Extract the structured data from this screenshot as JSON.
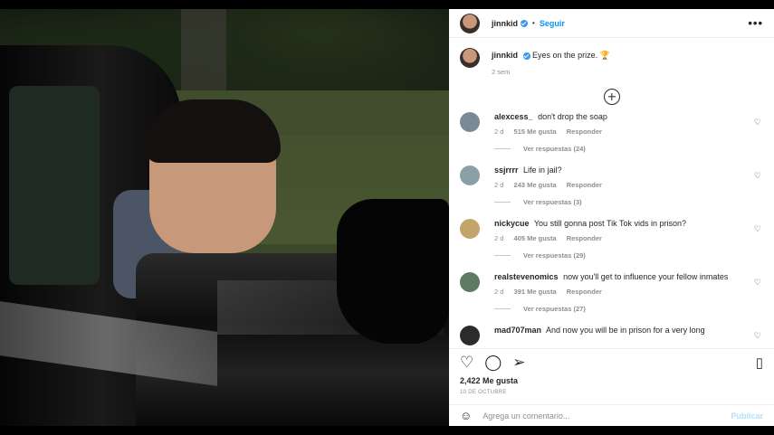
{
  "post": {
    "username": "jinnkid",
    "follow_label": "Seguir",
    "more_label": "•••",
    "caption": "Eyes on the prize. 🏆",
    "caption_time": "2 sem"
  },
  "comments": [
    {
      "user": "alexcess_",
      "text": "don't drop the soap",
      "time": "2 d",
      "likes": "515 Me gusta",
      "reply": "Responder",
      "view_replies": "Ver respuestas (24)",
      "avatar_color": "#7a8a94"
    },
    {
      "user": "ssjrrrr",
      "text": "Life in jail?",
      "time": "2 d",
      "likes": "243 Me gusta",
      "reply": "Responder",
      "view_replies": "Ver respuestas (3)",
      "avatar_color": "#8aa0a8"
    },
    {
      "user": "nickycue",
      "text": "You still gonna post Tik Tok vids in prison?",
      "time": "2 d",
      "likes": "405 Me gusta",
      "reply": "Responder",
      "view_replies": "Ver respuestas (29)",
      "avatar_color": "#c2a56a"
    },
    {
      "user": "realstevenomics",
      "text": "now you'll get to influence your fellow inmates",
      "time": "2 d",
      "likes": "391 Me gusta",
      "reply": "Responder",
      "view_replies": "Ver respuestas (27)",
      "avatar_color": "#5d7a62"
    },
    {
      "user": "mad707man",
      "text": "And now you will be in prison for a very long",
      "time": "",
      "likes": "",
      "reply": "",
      "view_replies": "",
      "avatar_color": "#2b2b2b"
    }
  ],
  "actions": {
    "likes": "2,422 Me gusta",
    "date": "10 DE OCTUBRE"
  },
  "add_comment": {
    "placeholder": "Agrega un comentario...",
    "post_label": "Publicar"
  },
  "icons": {
    "like": "heart-outline",
    "comment": "comment-bubble",
    "share": "paper-plane",
    "save": "bookmark",
    "emoji": "smiley-face",
    "load_more": "plus-circle"
  }
}
